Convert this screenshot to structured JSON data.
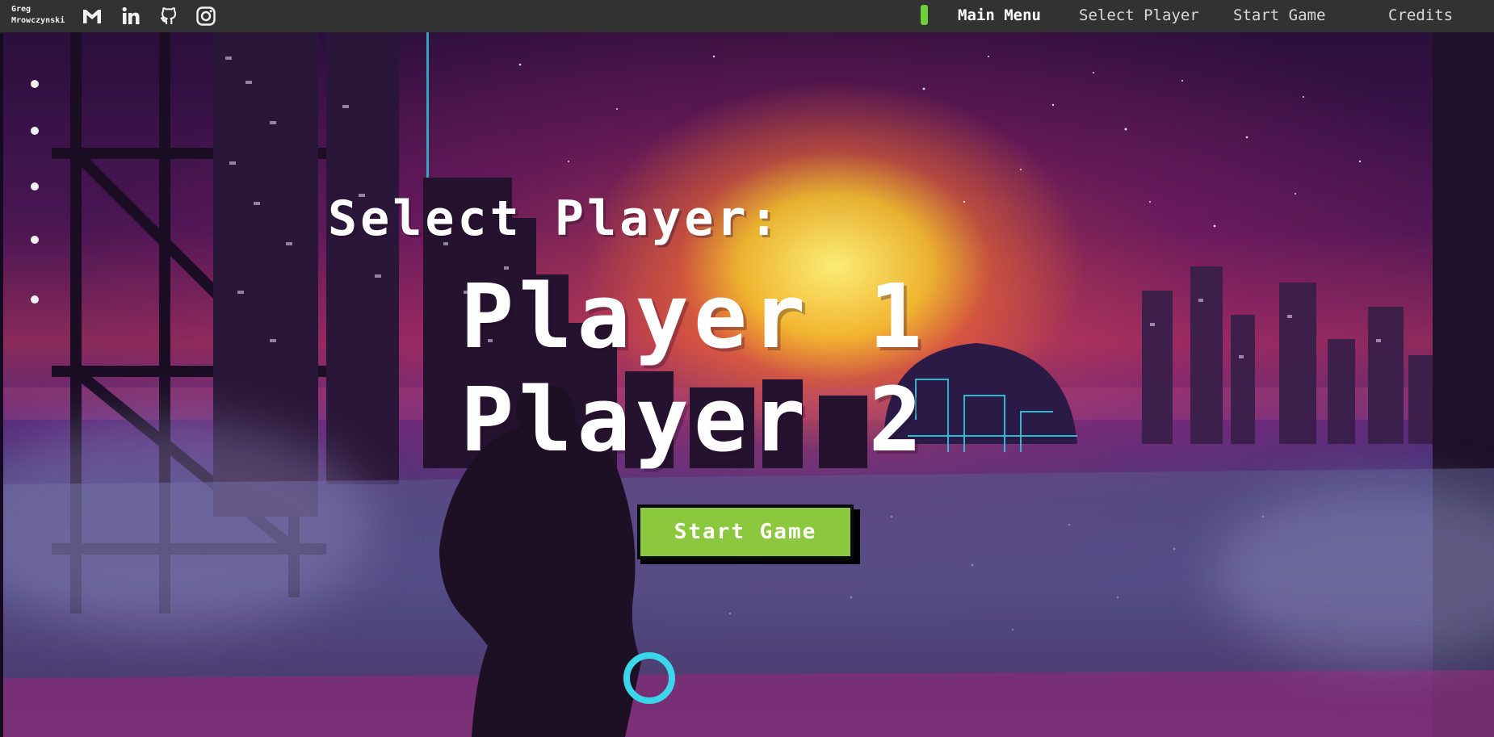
{
  "brand": {
    "line1": "Greg",
    "line2": "Mrowczynski"
  },
  "social": [
    "gmail-icon",
    "linkedin-icon",
    "github-icon",
    "instagram-icon"
  ],
  "nav": {
    "items": [
      {
        "label": "Main Menu",
        "active": true
      },
      {
        "label": "Select Player",
        "active": false
      },
      {
        "label": "Start Game",
        "active": false
      },
      {
        "label": "Credits",
        "active": false
      }
    ],
    "indicator_color": "#6fcf3a"
  },
  "quote": {
    "text": "",
    "author": ""
  },
  "heading": "Select Player:",
  "players": [
    {
      "label": "Player 1"
    },
    {
      "label": "Player 2"
    }
  ],
  "start_button": {
    "label": "Start Game",
    "color": "#8bc83d"
  },
  "side_dots": 5
}
